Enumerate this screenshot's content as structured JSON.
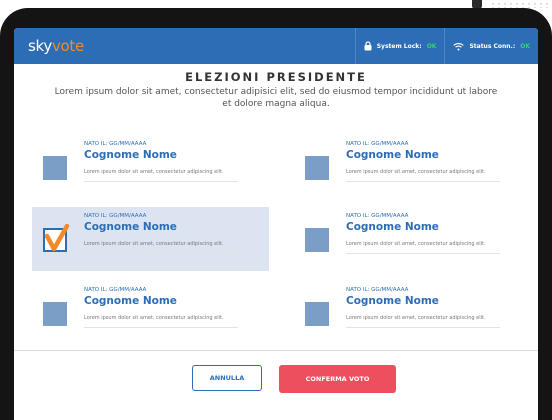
{
  "app": {
    "logo_sky": "sky",
    "logo_vote": "vote"
  },
  "status": {
    "lock_label": "System Lock:",
    "lock_value": "OK",
    "conn_label": "Status Conn.:",
    "conn_value": "OK"
  },
  "ballot": {
    "title": "ELEZIONI PRESIDENTE",
    "subtitle": "Lorem ipsum dolor sit amet, consectetur adipisici elit, sed do eiusmod tempor incididunt ut labore et dolore magna aliqua."
  },
  "candidates": [
    {
      "dob": "NATO IL: GG/MM/AAAA",
      "name": "Cognome Nome",
      "desc": "Lorem ipsum dolor sit amet, consectetur adipiscing elit.",
      "selected": false
    },
    {
      "dob": "NATO IL: GG/MM/AAAA",
      "name": "Cognome Nome",
      "desc": "Lorem ipsum dolor sit amet, consectetur adipiscing elit.",
      "selected": false
    },
    {
      "dob": "NATO IL: GG/MM/AAAA",
      "name": "Cognome Nome",
      "desc": "Lorem ipsum dolor sit amet, consectetur adipiscing elit.",
      "selected": true
    },
    {
      "dob": "NATO IL: GG/MM/AAAA",
      "name": "Cognome Nome",
      "desc": "Lorem ipsum dolor sit amet, consectetur adipiscing elit.",
      "selected": false
    },
    {
      "dob": "NATO IL: GG/MM/AAAA",
      "name": "Cognome Nome",
      "desc": "Lorem ipsum dolor sit amet, consectetur adipiscing elit.",
      "selected": false
    },
    {
      "dob": "NATO IL: GG/MM/AAAA",
      "name": "Cognome Nome",
      "desc": "Lorem ipsum dolor sit amet, consectetur adipiscing elit.",
      "selected": false
    }
  ],
  "actions": {
    "cancel_label": "ANNULLA",
    "confirm_label": "CONFERMA VOTO"
  },
  "colors": {
    "brand_blue": "#2d6db5",
    "brand_orange": "#f08a2a",
    "ok_green": "#35d07a",
    "confirm_red": "#ee4f5f",
    "selected_bg": "#dce4f2"
  },
  "icons": {
    "lock": "lock-icon",
    "wifi": "wifi-icon",
    "check": "checkmark-icon"
  }
}
